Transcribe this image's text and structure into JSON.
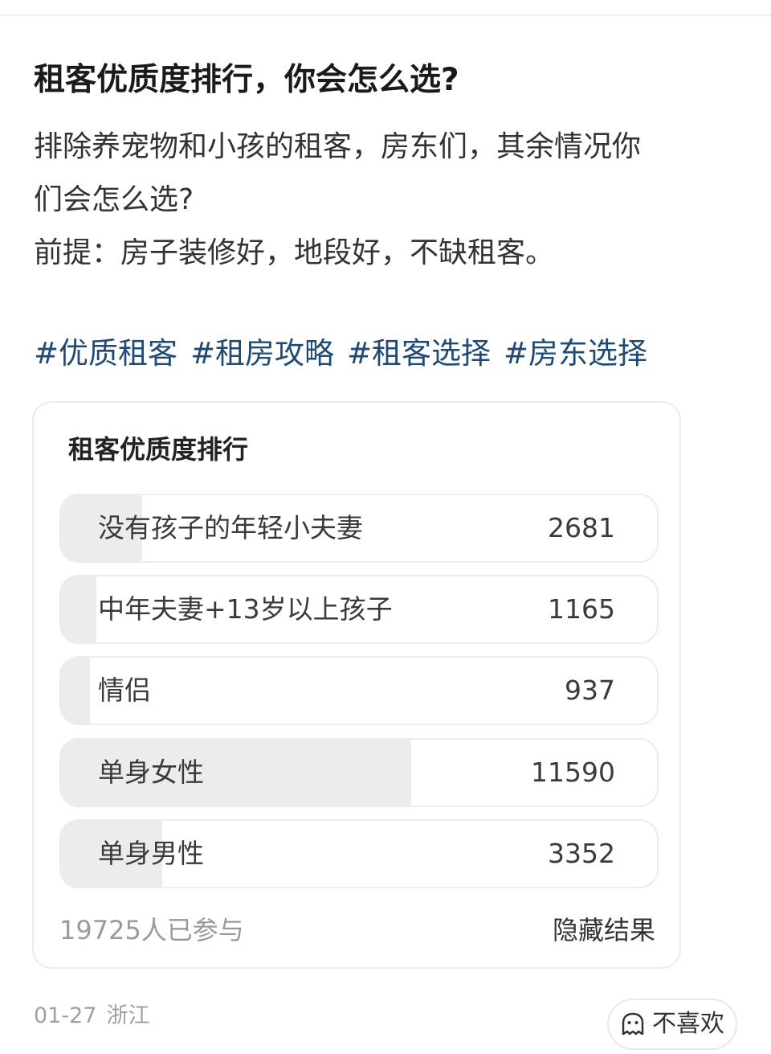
{
  "post": {
    "title": "租客优质度排行，你会怎么选?",
    "body_lines": [
      "排除养宠物和小孩的租客，房东们，其余情况你",
      "们会怎么选?",
      "前提：房子装修好，地段好，不缺租客。"
    ],
    "hashtags": [
      "#优质租客",
      "#租房攻略",
      "#租客选择",
      "#房东选择"
    ]
  },
  "poll": {
    "title": "租客优质度排行",
    "total_votes": 19725,
    "options": [
      {
        "label": "没有孩子的年轻小夫妻",
        "count": "2681",
        "share": 0.136
      },
      {
        "label": "中年夫妻+13岁以上孩子",
        "count": "1165",
        "share": 0.059
      },
      {
        "label": "情侣",
        "count": "937",
        "share": 0.048
      },
      {
        "label": "单身女性",
        "count": "11590",
        "share": 0.588
      },
      {
        "label": "单身男性",
        "count": "3352",
        "share": 0.17
      }
    ],
    "participants_label": "19725人已参与",
    "hide_results_label": "隐藏结果"
  },
  "meta": {
    "date": "01-27",
    "location": "浙江"
  },
  "dislike": {
    "label": "不喜欢",
    "icon": "dislike-face-icon"
  },
  "colors": {
    "hashtag": "#1e4a75",
    "poll_fill": "#ececec",
    "border": "#ececec",
    "muted_text": "#9a9a9a"
  }
}
